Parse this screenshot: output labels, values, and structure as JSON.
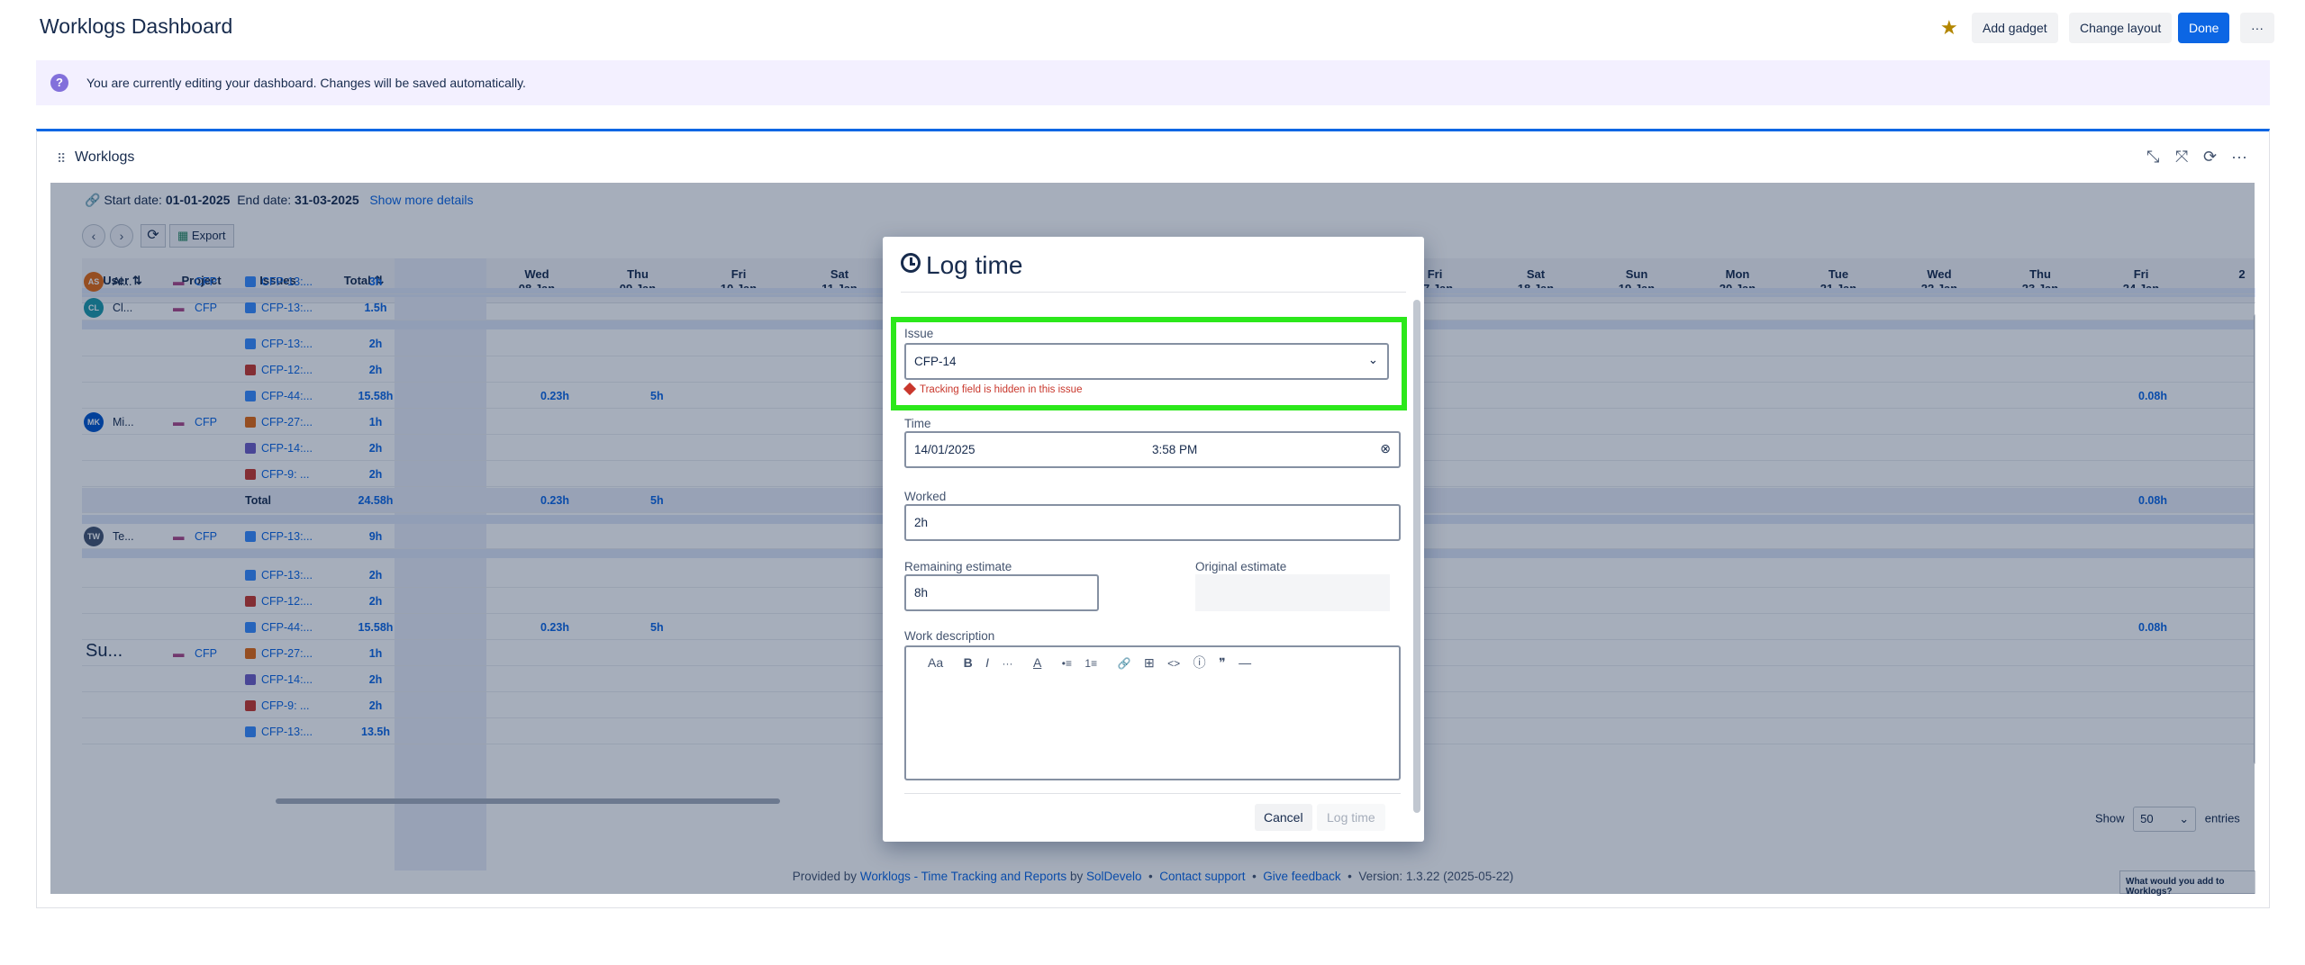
{
  "header": {
    "title": "Worklogs Dashboard",
    "add_gadget": "Add gadget",
    "change_layout": "Change layout",
    "done": "Done",
    "more": "···"
  },
  "banner": {
    "text": "You are currently editing your dashboard. Changes will be saved automatically."
  },
  "gadget": {
    "title": "Worklogs",
    "meta": {
      "start_label": "Start date:",
      "start": "01-01-2025",
      "end_label": "End date:",
      "end": "31-03-2025",
      "more": "Show more details"
    },
    "export": "Export",
    "columns": {
      "user": "User",
      "project": "Project",
      "issues": "Issues",
      "total": "Total"
    },
    "days": [
      {
        "dow": "Wed",
        "date": "08 Jan"
      },
      {
        "dow": "Thu",
        "date": "09 Jan"
      },
      {
        "dow": "Fri",
        "date": "10 Jan"
      },
      {
        "dow": "Sat",
        "date": "11 Jan"
      },
      {
        "dow": "Fri",
        "date": "17 Jan"
      },
      {
        "dow": "Sat",
        "date": "18 Jan"
      },
      {
        "dow": "Sun",
        "date": "19 Jan"
      },
      {
        "dow": "Mon",
        "date": "20 Jan"
      },
      {
        "dow": "Tue",
        "date": "21 Jan"
      },
      {
        "dow": "Wed",
        "date": "22 Jan"
      },
      {
        "dow": "Thu",
        "date": "23 Jan"
      },
      {
        "dow": "Fri",
        "date": "24 Jan"
      },
      {
        "dow": "2",
        "date": ""
      }
    ],
    "rows": [
      {
        "avatar": "AS",
        "user": "Al...",
        "project": "CFP",
        "issue": "CFP-13:...",
        "total": "3h"
      },
      {
        "avatar": "CL",
        "user": "Cl...",
        "project": "CFP",
        "issue": "CFP-13:...",
        "total": "1.5h"
      },
      {
        "issue": "CFP-13:...",
        "total": "2h"
      },
      {
        "issue": "CFP-12:...",
        "total": "2h"
      },
      {
        "issue": "CFP-44:...",
        "total": "15.58h",
        "wed": "0.23h",
        "thu": "5h",
        "fri24": "0.08h"
      },
      {
        "avatar": "MK",
        "user": "Mi...",
        "project": "CFP",
        "issue": "CFP-27:...",
        "total": "1h"
      },
      {
        "issue": "CFP-14:...",
        "total": "2h"
      },
      {
        "issue": "CFP-9: ...",
        "total": "2h"
      },
      {
        "total_label": "Total",
        "total": "24.58h",
        "wed": "0.23h",
        "thu": "5h",
        "fri24": "0.08h"
      },
      {
        "avatar": "TW",
        "user": "Te...",
        "project": "CFP",
        "issue": "CFP-13:...",
        "total": "9h"
      },
      {
        "issue": "CFP-13:...",
        "total": "2h"
      },
      {
        "issue": "CFP-12:...",
        "total": "2h"
      },
      {
        "issue": "CFP-44:...",
        "total": "15.58h",
        "wed": "0.23h",
        "thu": "5h",
        "fri24": "0.08h"
      },
      {
        "user": "Su...",
        "project": "CFP",
        "issue": "CFP-27:...",
        "total": "1h"
      },
      {
        "issue": "CFP-14:...",
        "total": "2h"
      },
      {
        "issue": "CFP-9: ...",
        "total": "2h"
      },
      {
        "issue": "CFP-13:...",
        "total": "13.5h"
      }
    ],
    "show": {
      "label": "Show",
      "value": "50",
      "suffix": "entries"
    },
    "footer": {
      "prefix": "Provided by",
      "app": "Worklogs - Time Tracking and Reports",
      "by": "by",
      "vendor": "SolDevelo",
      "support": "Contact support",
      "feedback": "Give feedback",
      "version": "Version: 1.3.22 (2025-05-22)"
    },
    "feedback_btn": "What would you add to Worklogs?"
  },
  "modal": {
    "title": "Log time",
    "issue_label": "Issue",
    "issue_value": "CFP-14",
    "issue_error": "Tracking field is hidden in this issue",
    "time_label": "Time",
    "date_value": "14/01/2025",
    "time_value": "3:58 PM",
    "worked_label": "Worked",
    "worked_value": "2h",
    "remaining_label": "Remaining estimate",
    "remaining_value": "8h",
    "original_label": "Original estimate",
    "description_label": "Work description",
    "toolbar": [
      "Aa",
      "B",
      "I",
      "···",
      "A",
      "•≡",
      "1≡",
      "🔗",
      "⊞",
      "<>",
      "ⓘ",
      "❞",
      "—"
    ],
    "cancel": "Cancel",
    "submit": "Log time"
  },
  "colors": {
    "primary": "#0c66e4",
    "highlight": "#2ce81b",
    "error": "#c9372c"
  }
}
